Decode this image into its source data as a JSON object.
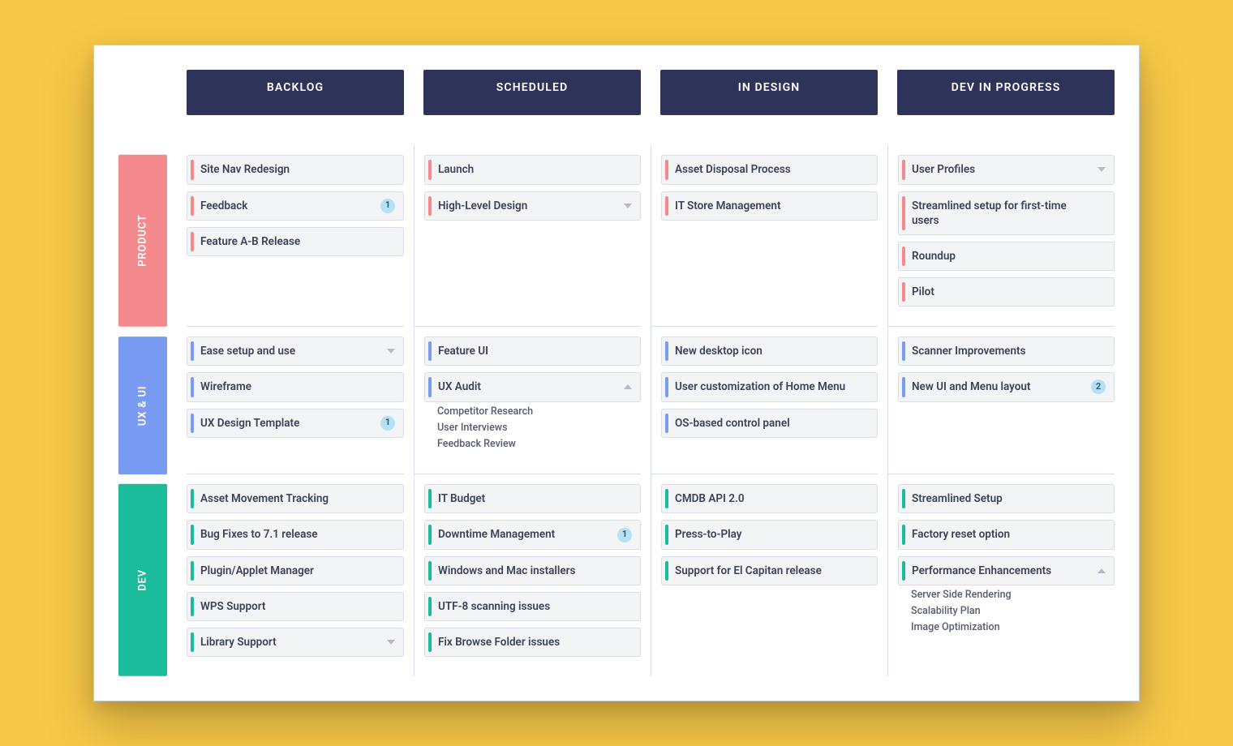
{
  "columns": {
    "backlog": "BACKLOG",
    "scheduled": "SCHEDULED",
    "in_design": "IN DESIGN",
    "dev_in_progress": "DEV IN PROGRESS"
  },
  "lanes": {
    "product": {
      "label": "PRODUCT",
      "backlog": [
        {
          "title": "Site Nav Redesign"
        },
        {
          "title": "Feedback",
          "badge": "1"
        },
        {
          "title": "Feature A-B Release"
        }
      ],
      "scheduled": [
        {
          "title": "Launch"
        },
        {
          "title": "High-Level Design",
          "caret": "down"
        }
      ],
      "in_design": [
        {
          "title": "Asset Disposal Process"
        },
        {
          "title": "IT Store Management"
        }
      ],
      "dev_in_progress": [
        {
          "title": "User Profiles",
          "caret": "down"
        },
        {
          "title": "Streamlined setup for first-time users"
        },
        {
          "title": "Roundup"
        },
        {
          "title": "Pilot"
        }
      ]
    },
    "ux": {
      "label": "UX & UI",
      "backlog": [
        {
          "title": "Ease setup and use",
          "caret": "down"
        },
        {
          "title": "Wireframe"
        },
        {
          "title": "UX Design Template",
          "badge": "1"
        }
      ],
      "scheduled": [
        {
          "title": "Feature UI"
        },
        {
          "title": "UX Audit",
          "caret": "up",
          "subtasks": [
            "Competitor Research",
            "User Interviews",
            "Feedback Review"
          ]
        }
      ],
      "in_design": [
        {
          "title": "New desktop icon"
        },
        {
          "title": "User customization of Home Menu"
        },
        {
          "title": "OS-based control panel"
        }
      ],
      "dev_in_progress": [
        {
          "title": "Scanner Improvements"
        },
        {
          "title": "New UI and Menu layout",
          "badge": "2"
        }
      ]
    },
    "dev": {
      "label": "DEV",
      "backlog": [
        {
          "title": "Asset Movement Tracking"
        },
        {
          "title": "Bug Fixes to 7.1 release"
        },
        {
          "title": "Plugin/Applet Manager"
        },
        {
          "title": "WPS Support"
        },
        {
          "title": "Library Support",
          "caret": "down"
        }
      ],
      "scheduled": [
        {
          "title": "IT Budget"
        },
        {
          "title": "Downtime Management",
          "badge": "1"
        },
        {
          "title": "Windows and Mac installers"
        },
        {
          "title": "UTF-8 scanning issues"
        },
        {
          "title": "Fix Browse Folder issues"
        }
      ],
      "in_design": [
        {
          "title": "CMDB API 2.0"
        },
        {
          "title": "Press-to-Play"
        },
        {
          "title": "Support for El Capitan release"
        }
      ],
      "dev_in_progress": [
        {
          "title": "Streamlined Setup"
        },
        {
          "title": "Factory reset option"
        },
        {
          "title": "Performance Enhancements",
          "caret": "up",
          "subtasks": [
            "Server Side Rendering",
            "Scalability Plan",
            "Image Optimization"
          ]
        }
      ]
    }
  }
}
